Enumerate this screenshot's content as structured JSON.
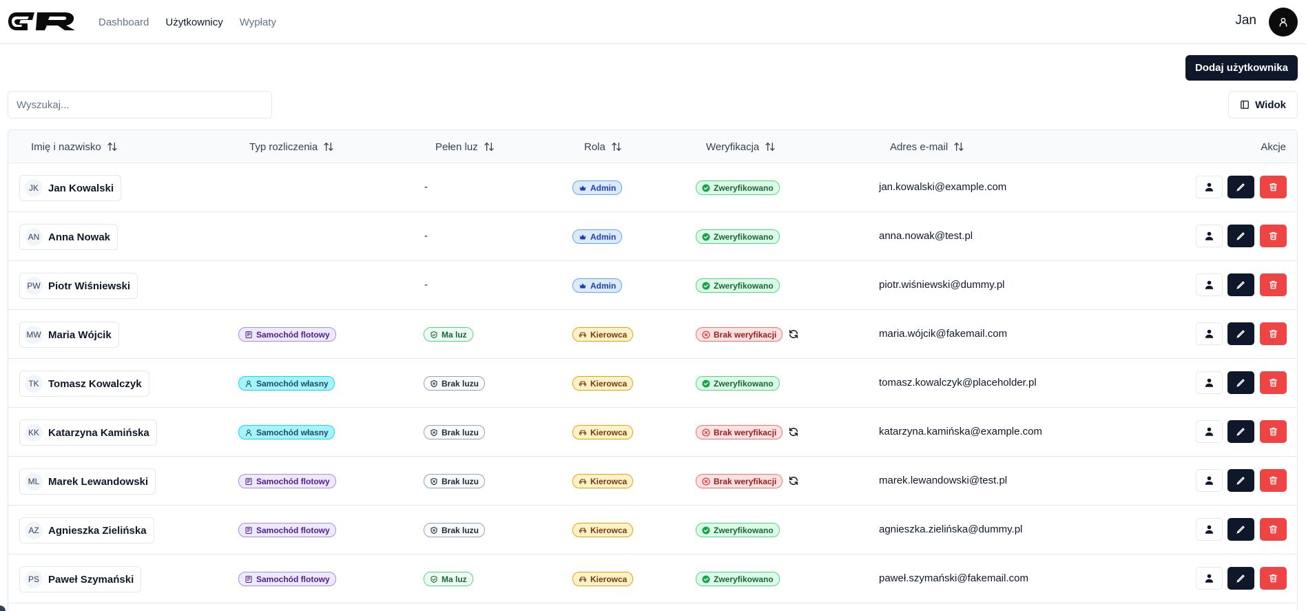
{
  "header": {
    "nav": [
      "Dashboard",
      "Użytkownicy",
      "Wypłaty"
    ],
    "active_nav": "Użytkownicy",
    "user_name": "Jan"
  },
  "toolbar": {
    "add_label": "Dodaj użytkownika",
    "search_placeholder": "Wyszukaj...",
    "view_label": "Widok"
  },
  "columns": {
    "name": "Imię i nazwisko",
    "billing": "Typ rozliczenia",
    "full_slack": "Pełen luz",
    "role": "Rola",
    "verification": "Weryfikacja",
    "email": "Adres e-mail",
    "actions": "Akcje"
  },
  "rows": [
    {
      "initials": "JK",
      "name": "Jan Kowalski",
      "billing": "",
      "slack": "-",
      "role": "Admin",
      "verification": "Zweryfikowano",
      "email": "jan.kowalski@example.com"
    },
    {
      "initials": "AN",
      "name": "Anna Nowak",
      "billing": "",
      "slack": "-",
      "role": "Admin",
      "verification": "Zweryfikowano",
      "email": "anna.nowak@test.pl"
    },
    {
      "initials": "PW",
      "name": "Piotr Wiśniewski",
      "billing": "",
      "slack": "-",
      "role": "Admin",
      "verification": "Zweryfikowano",
      "email": "piotr.wiśniewski@dummy.pl"
    },
    {
      "initials": "MW",
      "name": "Maria Wójcik",
      "billing": "Samochód flotowy",
      "slack": "Ma luz",
      "role": "Kierowca",
      "verification": "Brak weryfikacji",
      "email": "maria.wójcik@fakemail.com"
    },
    {
      "initials": "TK",
      "name": "Tomasz Kowalczyk",
      "billing": "Samochód własny",
      "slack": "Brak luzu",
      "role": "Kierowca",
      "verification": "Zweryfikowano",
      "email": "tomasz.kowalczyk@placeholder.pl"
    },
    {
      "initials": "KK",
      "name": "Katarzyna Kamińska",
      "billing": "Samochód własny",
      "slack": "Brak luzu",
      "role": "Kierowca",
      "verification": "Brak weryfikacji",
      "email": "katarzyna.kamińska@example.com"
    },
    {
      "initials": "ML",
      "name": "Marek Lewandowski",
      "billing": "Samochód flotowy",
      "slack": "Brak luzu",
      "role": "Kierowca",
      "verification": "Brak weryfikacji",
      "email": "marek.lewandowski@test.pl"
    },
    {
      "initials": "AZ",
      "name": "Agnieszka Zielińska",
      "billing": "Samochód flotowy",
      "slack": "Brak luzu",
      "role": "Kierowca",
      "verification": "Zweryfikowano",
      "email": "agnieszka.zielińska@dummy.pl"
    },
    {
      "initials": "PS",
      "name": "Paweł Szymański",
      "billing": "Samochód flotowy",
      "slack": "Ma luz",
      "role": "Kierowca",
      "verification": "Zweryfikowano",
      "email": "paweł.szymański@fakemail.com"
    }
  ],
  "colors": {
    "primary": "#0f172a",
    "danger": "#ef4444",
    "border": "#e2e8f0"
  }
}
